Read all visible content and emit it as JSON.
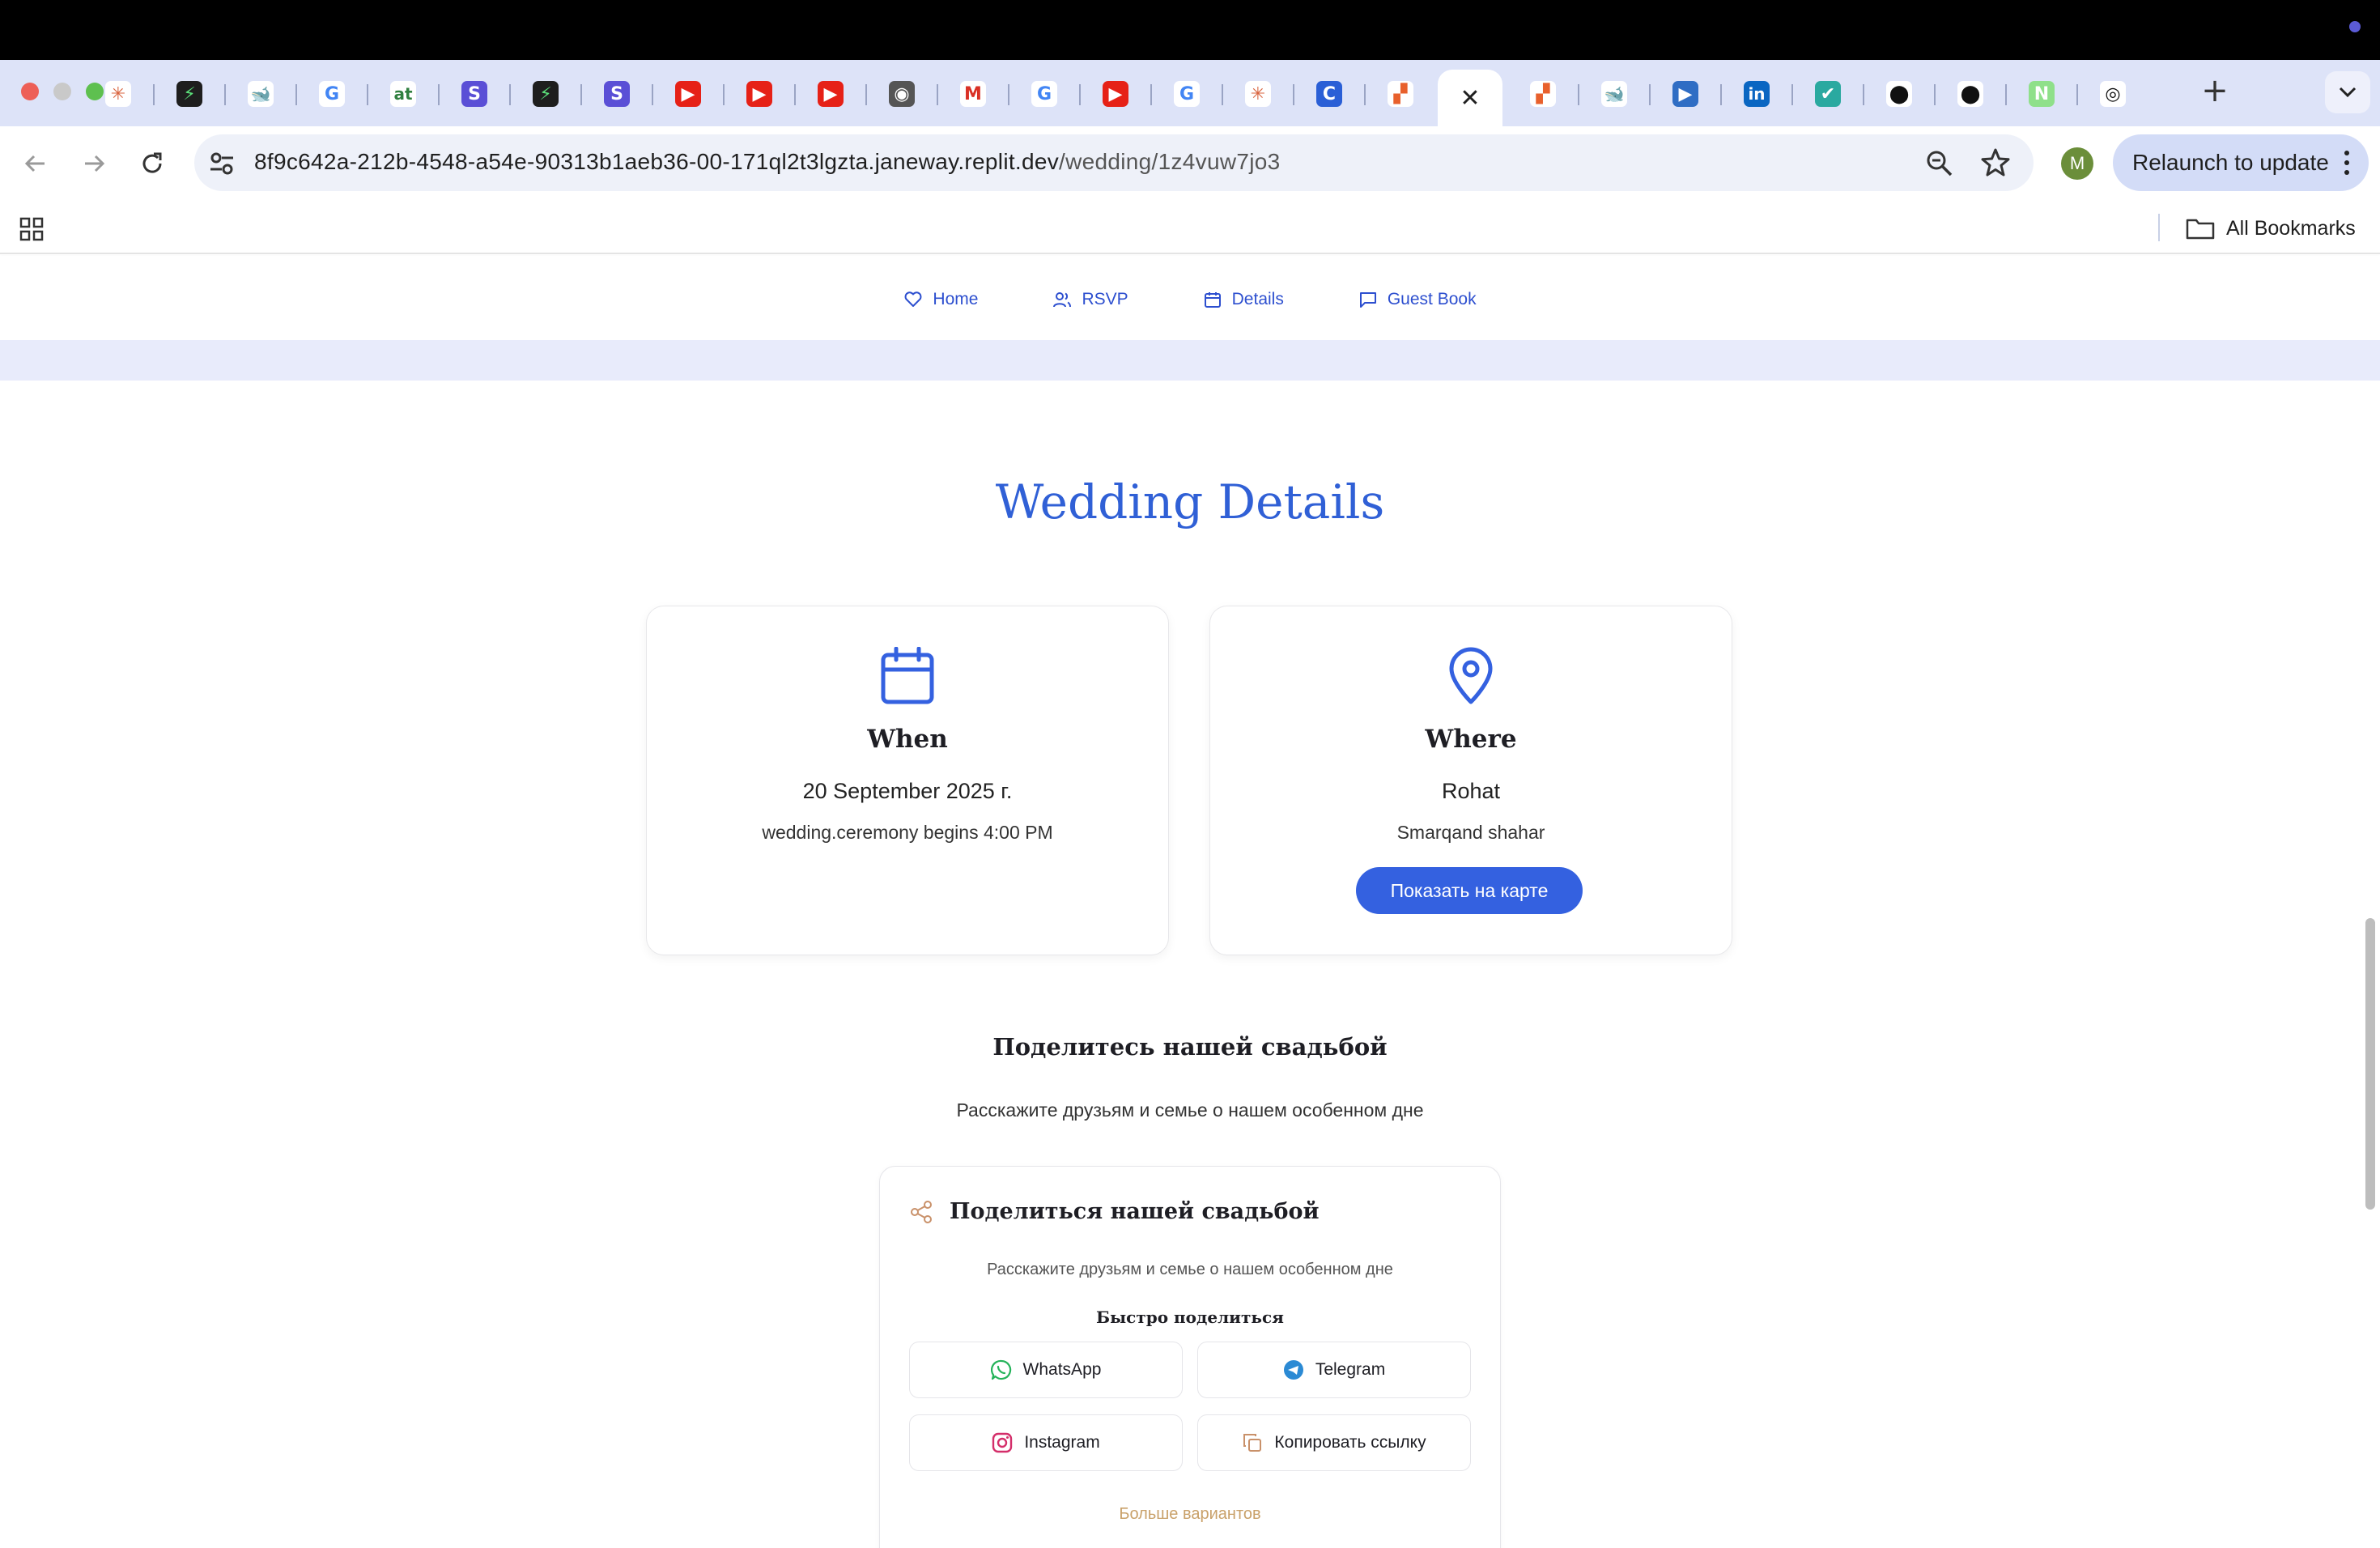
{
  "browser": {
    "tabs_count": 29,
    "active_tab_close": "✕",
    "new_tab": "+",
    "tab_menu": "⌄",
    "address": {
      "host": "8f9c642a-212b-4548-a54e-90313b1aeb36-00-171ql2t3lgzta.janeway.replit.dev",
      "path": "/wedding/1z4vuw7jo3"
    },
    "avatar_letter": "M",
    "relaunch_label": "Relaunch to update",
    "bookmarks_label": "All Bookmarks"
  },
  "site_nav": {
    "items": [
      {
        "label": "Home",
        "icon": "heart-icon"
      },
      {
        "label": "RSVP",
        "icon": "users-icon"
      },
      {
        "label": "Details",
        "icon": "calendar-icon"
      },
      {
        "label": "Guest Book",
        "icon": "message-icon"
      }
    ]
  },
  "details": {
    "title": "Wedding Details",
    "when": {
      "title": "When",
      "date": "20 September 2025 г.",
      "time": "wedding.ceremony begins 4:00 PM",
      "icon": "calendar-icon"
    },
    "where": {
      "title": "Where",
      "venue": "Rohat",
      "city": "Smarqand shahar",
      "map_button": "Показать на карте",
      "icon": "map-pin-icon"
    }
  },
  "share": {
    "title": "Поделитесь нашей свадьбой",
    "subtitle": "Расскажите друзьям и семье о нашем особенном дне",
    "card": {
      "title": "Поделиться нашей свадьбой",
      "subtitle": "Расскажите друзьям и семье о нашем особенном дне",
      "quick_label": "Быстро поделиться",
      "buttons": {
        "whatsapp": "WhatsApp",
        "telegram": "Telegram",
        "instagram": "Instagram",
        "copy": "Копировать ссылку"
      },
      "more": "Больше вариантов"
    }
  },
  "colors": {
    "accent": "#3461e0",
    "nav_text": "#2d4fcf",
    "nav_strip": "#e8ebfb",
    "more_link": "#c9a16a"
  }
}
